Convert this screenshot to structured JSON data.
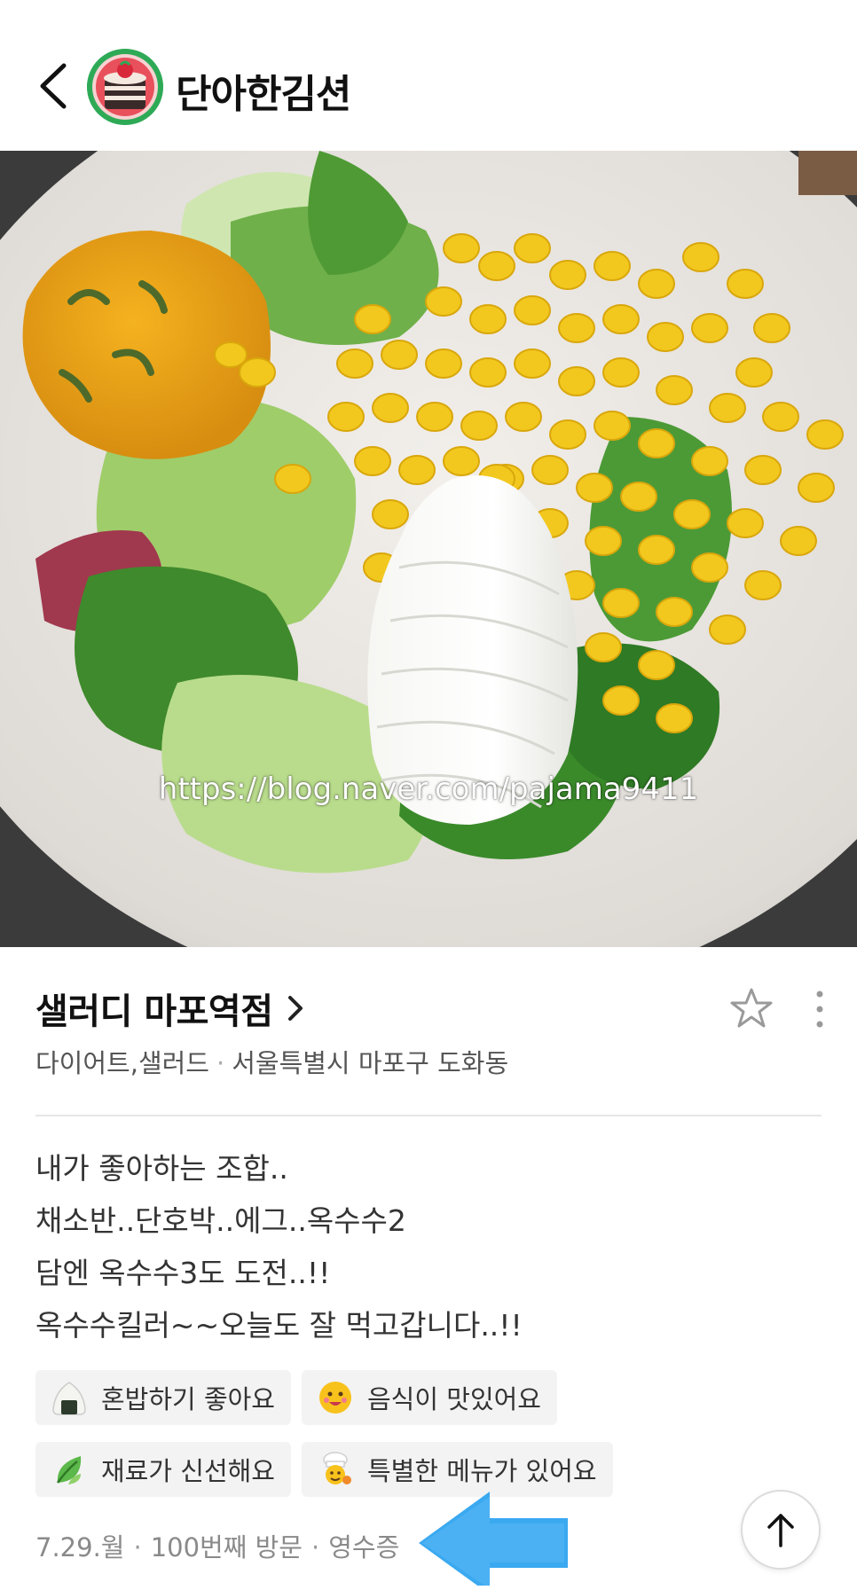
{
  "header": {
    "author_name": "단아한김션"
  },
  "photo": {
    "watermark": "https://blog.naver.com/pajama9411"
  },
  "place": {
    "name": "샐러디 마포역점",
    "category": "다이어트,샐러드",
    "separator": "·",
    "address": "서울특별시 마포구 도화동"
  },
  "review": {
    "lines": [
      "내가 좋아하는 조합..",
      "채소반..단호박..에그..옥수수2",
      "담엔 옥수수3도 도전..!!",
      "옥수수킬러~~오늘도 잘 먹고갑니다..!!"
    ]
  },
  "tags": [
    {
      "label": "혼밥하기 좋아요",
      "icon": "rice-ball-icon"
    },
    {
      "label": "음식이 맛있어요",
      "icon": "smiley-icon"
    },
    {
      "label": "재료가 신선해요",
      "icon": "leaf-icon"
    },
    {
      "label": "특별한 메뉴가 있어요",
      "icon": "chef-icon"
    }
  ],
  "footer": {
    "date": "7.29.월",
    "dot": "·",
    "visit": "100번째 방문",
    "receipt": "영수증"
  },
  "colors": {
    "annotation_arrow": "#3aa9f0",
    "tag_bg": "#f3f3f3"
  }
}
